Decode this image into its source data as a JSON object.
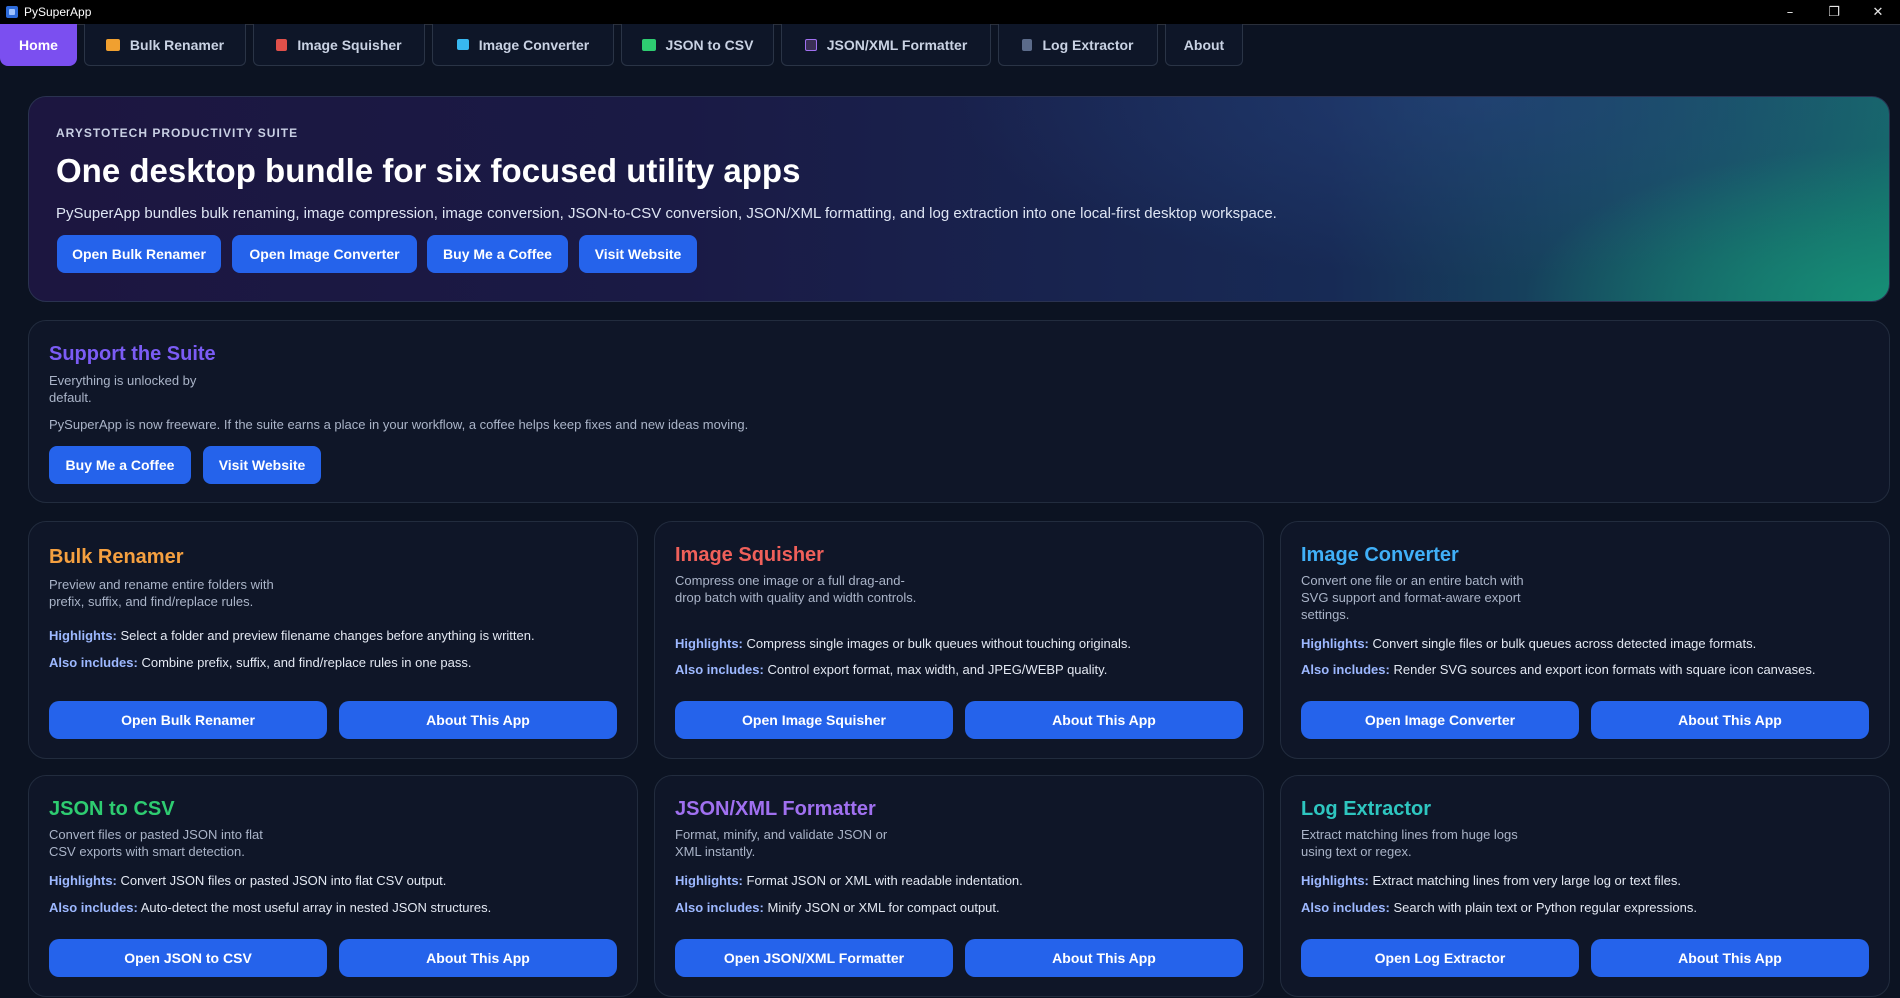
{
  "window": {
    "title": "PySuperApp",
    "minimize": "–",
    "maximize": "❐",
    "close": "✕"
  },
  "tabs": [
    {
      "label": "Home"
    },
    {
      "label": "Bulk Renamer",
      "icon": "folder-icon",
      "color": "#f0a030"
    },
    {
      "label": "Image Squisher",
      "icon": "squisher-icon",
      "color": "#e0504a"
    },
    {
      "label": "Image Converter",
      "icon": "converter-icon",
      "color": "#38b8f0"
    },
    {
      "label": "JSON to CSV",
      "icon": "json-csv-icon",
      "color": "#2ecc71"
    },
    {
      "label": "JSON/XML Formatter",
      "icon": "formatter-icon",
      "color": "#a070f0"
    },
    {
      "label": "Log Extractor",
      "icon": "log-icon",
      "color": "#5b6b8a"
    },
    {
      "label": "About"
    }
  ],
  "hero": {
    "eyebrow": "ARYSTOTECH PRODUCTIVITY SUITE",
    "title": "One desktop bundle for six focused utility apps",
    "description": "PySuperApp bundles bulk renaming, image compression, image conversion, JSON-to-CSV conversion, JSON/XML formatting, and log extraction into one local-first desktop workspace.",
    "buttons": [
      "Open Bulk Renamer",
      "Open Image Converter",
      "Buy Me a Coffee",
      "Visit Website"
    ]
  },
  "support": {
    "title": "Support the Suite",
    "subtitle": "Everything is unlocked by default.",
    "body": "PySuperApp is now freeware. If the suite earns a place in your workflow, a coffee helps keep fixes and new ideas moving.",
    "buttons": [
      "Buy Me a Coffee",
      "Visit Website"
    ]
  },
  "labels": {
    "highlights": "Highlights:",
    "also": "Also includes:",
    "about_button": "About This App"
  },
  "apps": [
    {
      "title": "Bulk Renamer",
      "color": "#f5a040",
      "description": "Preview and rename entire folders with prefix, suffix, and find/replace rules.",
      "highlights": "Select a folder and preview filename changes before anything is written.",
      "also": "Combine prefix, suffix, and find/replace rules in one pass.",
      "open_button": "Open Bulk Renamer"
    },
    {
      "title": "Image Squisher",
      "color": "#f0605a",
      "description": "Compress one image or a full drag-and-drop batch with quality and width controls.",
      "highlights": "Compress single images or bulk queues without touching originals.",
      "also": "Control export format, max width, and JPEG/WEBP quality.",
      "open_button": "Open Image Squisher"
    },
    {
      "title": "Image Converter",
      "color": "#40b0f8",
      "description": "Convert one file or an entire batch with SVG support and format-aware export settings.",
      "highlights": "Convert single files or bulk queues across detected image formats.",
      "also": "Render SVG sources and export icon formats with square icon canvases.",
      "open_button": "Open Image Converter"
    },
    {
      "title": "JSON to CSV",
      "color": "#2ecc71",
      "description": "Convert files or pasted JSON into flat CSV exports with smart detection.",
      "highlights": "Convert JSON files or pasted JSON into flat CSV output.",
      "also": "Auto-detect the most useful array in nested JSON structures.",
      "open_button": "Open JSON to CSV"
    },
    {
      "title": "JSON/XML Formatter",
      "color": "#a070f0",
      "description": "Format, minify, and validate JSON or XML instantly.",
      "highlights": "Format JSON or XML with readable indentation.",
      "also": "Minify JSON or XML for compact output.",
      "open_button": "Open JSON/XML Formatter"
    },
    {
      "title": "Log Extractor",
      "color": "#2ec6c0",
      "description": "Extract matching lines from huge logs using text or regex.",
      "highlights": "Extract matching lines from very large log or text files.",
      "also": "Search with plain text or Python regular expressions.",
      "open_button": "Open Log Extractor"
    }
  ]
}
